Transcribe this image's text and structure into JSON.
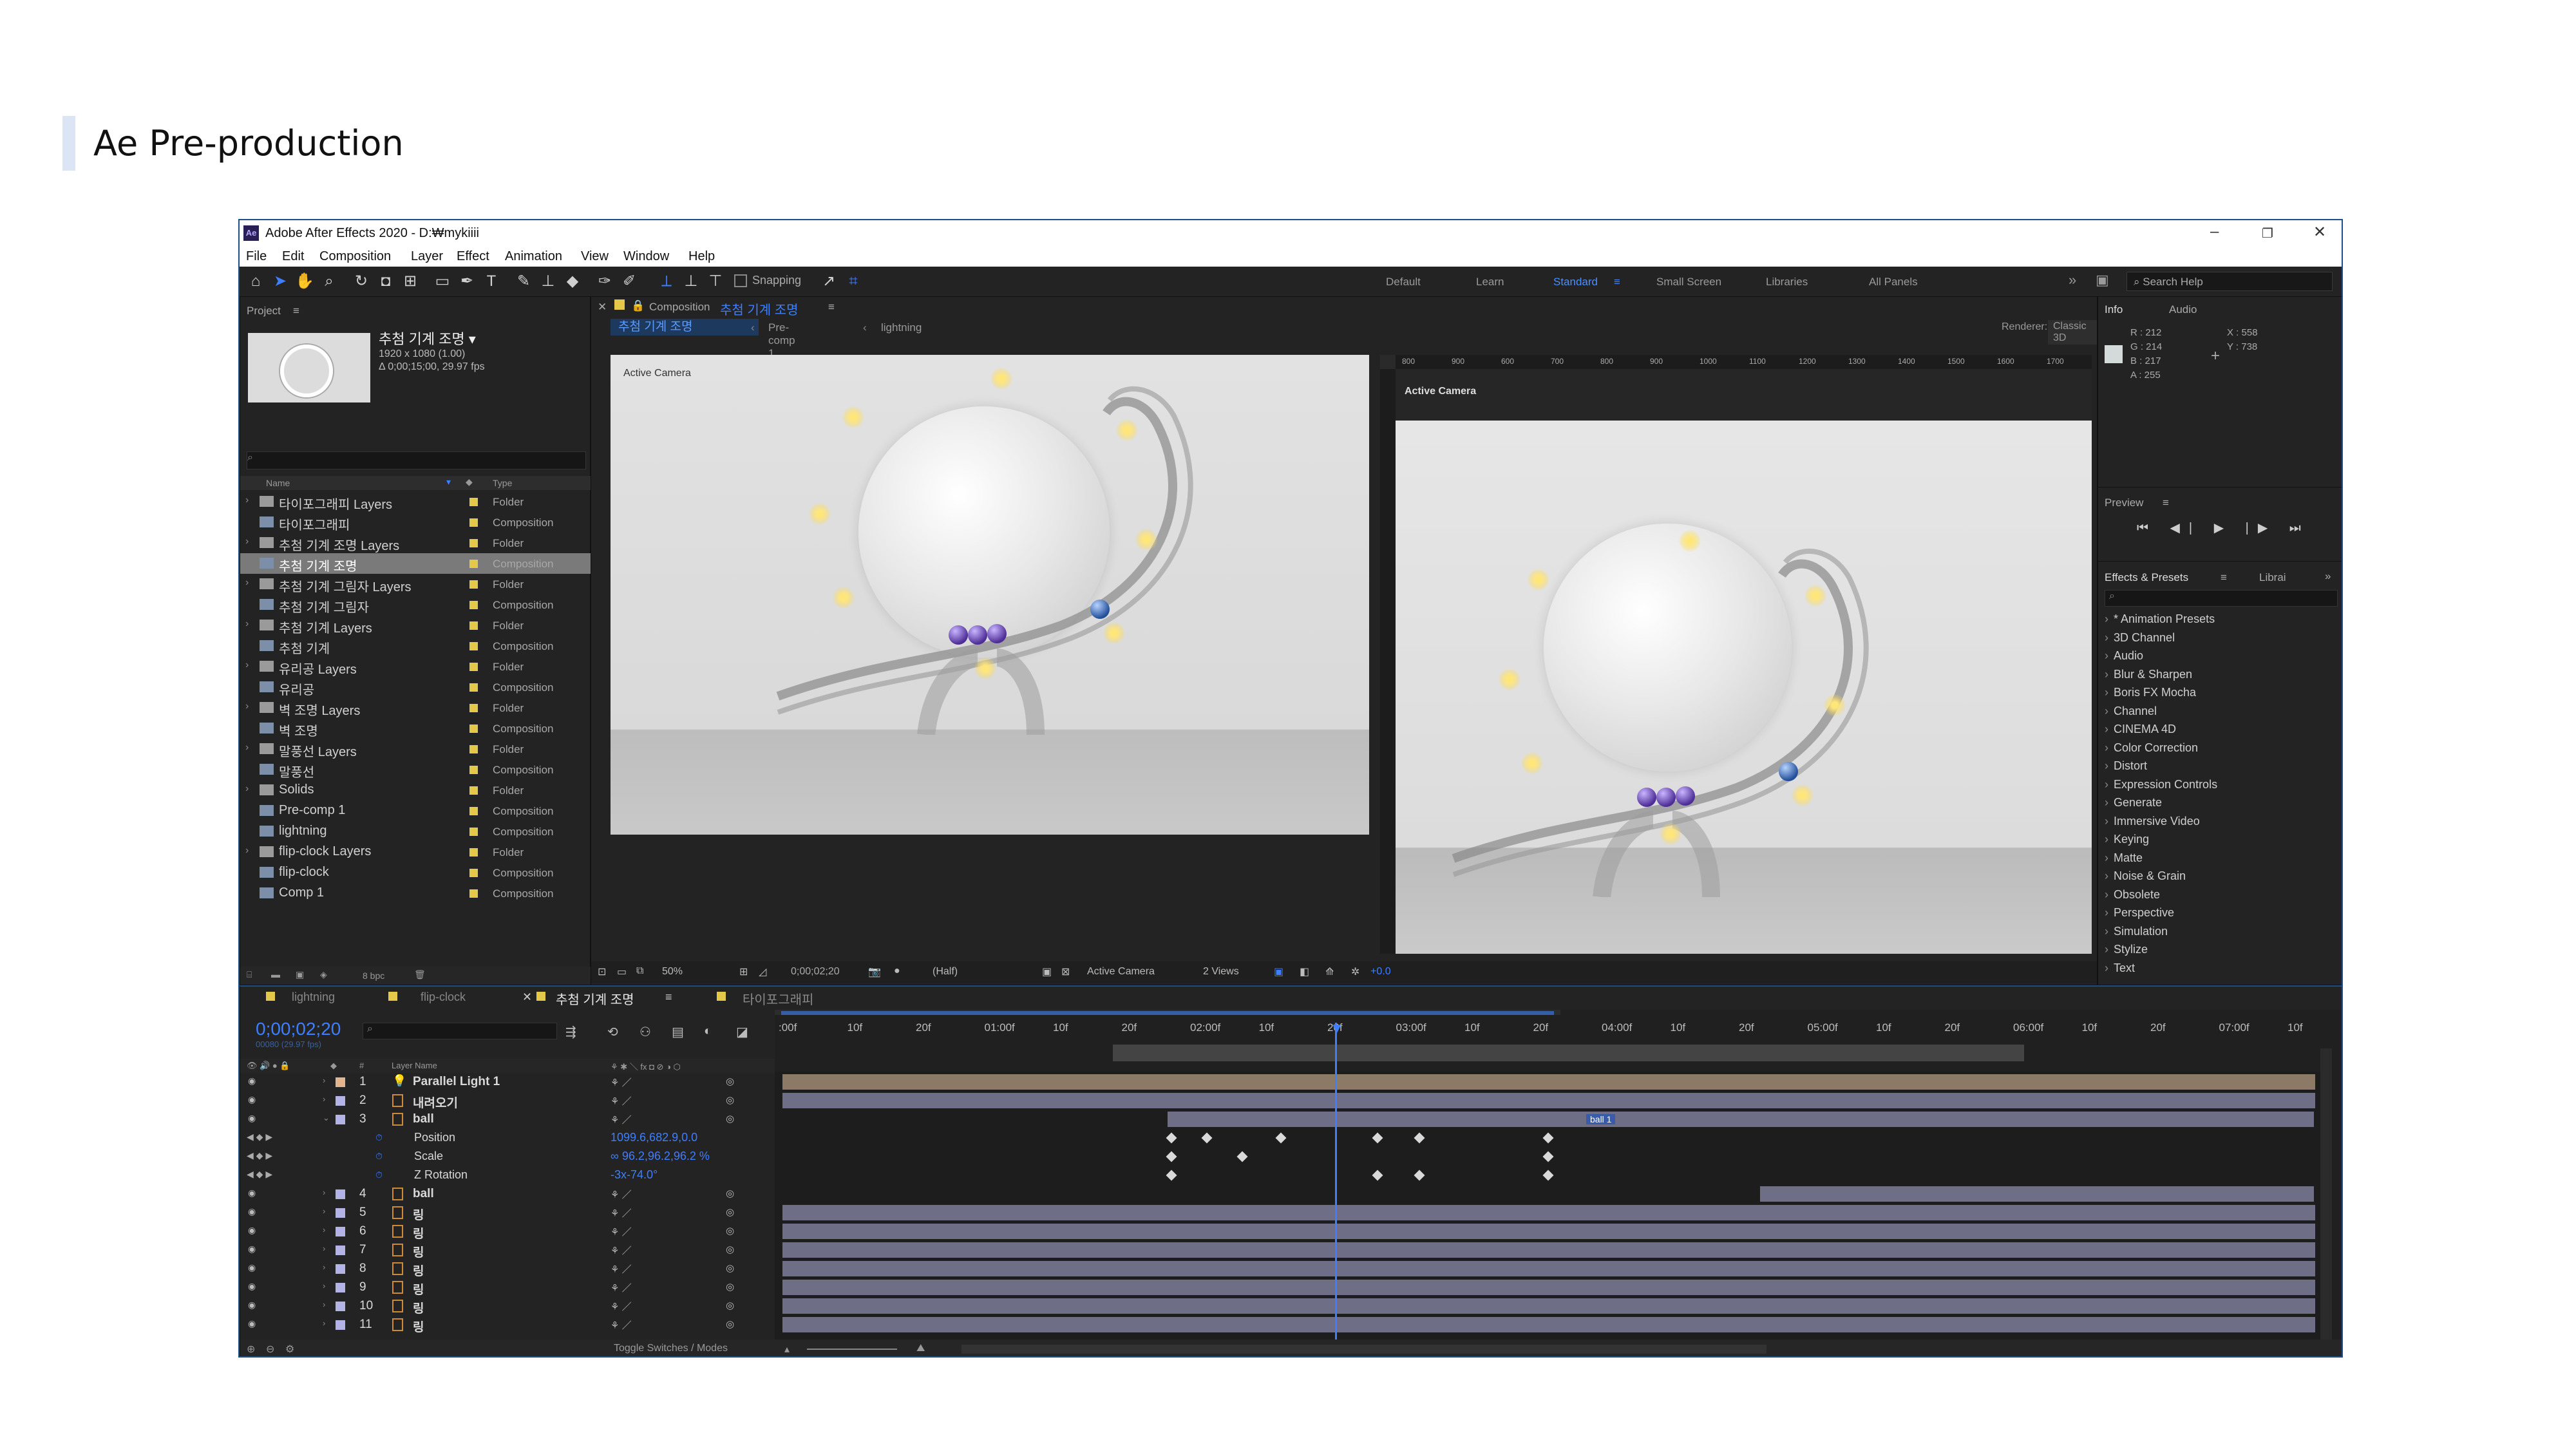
{
  "slide": {
    "title": "Ae Pre-production"
  },
  "window": {
    "title": "Adobe After Effects 2020 - D:₩mykiiii",
    "menu": [
      "File",
      "Edit",
      "Composition",
      "Layer",
      "Effect",
      "Animation",
      "View",
      "Window",
      "Help"
    ],
    "snapping": "Snapping",
    "workspaces": [
      "Default",
      "Learn",
      "Standard",
      "Small Screen",
      "Libraries",
      "All Panels"
    ],
    "active_workspace": "Standard",
    "search_help": "Search Help"
  },
  "project": {
    "tab": "Project",
    "comp_name": "추첨 기계 조명 ▾",
    "comp_res": "1920 x 1080 (1.00)",
    "comp_dur": "Δ 0;00;15;00, 29.97 fps",
    "col_name": "Name",
    "col_type": "Type",
    "bpc": "8 bpc",
    "items": [
      {
        "name": "타이포그래피 Layers",
        "type": "Folder",
        "kind": "folder",
        "chev": true
      },
      {
        "name": "타이포그래피",
        "type": "Composition",
        "kind": "comp"
      },
      {
        "name": "추첨 기계 조명 Layers",
        "type": "Folder",
        "kind": "folder",
        "chev": true
      },
      {
        "name": "추첨 기계 조명",
        "type": "Composition",
        "kind": "comp",
        "selected": true
      },
      {
        "name": "추첨 기계 그림자 Layers",
        "type": "Folder",
        "kind": "folder",
        "chev": true
      },
      {
        "name": "추첨 기계 그림자",
        "type": "Composition",
        "kind": "comp"
      },
      {
        "name": "추첨 기계 Layers",
        "type": "Folder",
        "kind": "folder",
        "chev": true
      },
      {
        "name": "추첨 기계",
        "type": "Composition",
        "kind": "comp"
      },
      {
        "name": "유리공 Layers",
        "type": "Folder",
        "kind": "folder",
        "chev": true
      },
      {
        "name": "유리공",
        "type": "Composition",
        "kind": "comp"
      },
      {
        "name": "벽 조명 Layers",
        "type": "Folder",
        "kind": "folder",
        "chev": true
      },
      {
        "name": "벽 조명",
        "type": "Composition",
        "kind": "comp"
      },
      {
        "name": "말풍선 Layers",
        "type": "Folder",
        "kind": "folder",
        "chev": true
      },
      {
        "name": "말풍선",
        "type": "Composition",
        "kind": "comp"
      },
      {
        "name": "Solids",
        "type": "Folder",
        "kind": "folder",
        "chev": true
      },
      {
        "name": "Pre-comp 1",
        "type": "Composition",
        "kind": "comp"
      },
      {
        "name": "lightning",
        "type": "Composition",
        "kind": "comp"
      },
      {
        "name": "flip-clock Layers",
        "type": "Folder",
        "kind": "folder",
        "chev": true
      },
      {
        "name": "flip-clock",
        "type": "Composition",
        "kind": "comp"
      },
      {
        "name": "Comp 1",
        "type": "Composition",
        "kind": "comp"
      }
    ]
  },
  "composition": {
    "tab_prefix": "Composition",
    "tab_name": "추첨 기계 조명",
    "crumbs": [
      "추첨 기계 조명",
      "Pre-comp 1",
      "lightning"
    ],
    "renderer_label": "Renderer:",
    "renderer": "Classic 3D",
    "view1_label": "Active Camera",
    "view2_label": "Active Camera",
    "ruler_ticks": [
      "800",
      "900",
      "600",
      "700",
      "800",
      "900",
      "1000",
      "1100",
      "1200",
      "1300",
      "1400",
      "1500",
      "1600",
      "1700"
    ],
    "zoom": "50%",
    "time": "0;00;02;20",
    "resolution": "(Half)",
    "camera": "Active Camera",
    "views": "2 Views",
    "exposure": "+0.0"
  },
  "info": {
    "tabs": [
      "Info",
      "Audio"
    ],
    "r": "R : 212",
    "g": "G : 214",
    "b": "B : 217",
    "a": "A : 255",
    "x": "X : 558",
    "y": "Y : 738",
    "swatch_color": "#d4d6d9"
  },
  "preview": {
    "tab": "Preview",
    "controls": "⏮ ◀| ▶ |▶ ⏭"
  },
  "effects": {
    "tab": "Effects & Presets",
    "tab2": "Librai",
    "items": [
      "* Animation Presets",
      "3D Channel",
      "Audio",
      "Blur & Sharpen",
      "Boris FX Mocha",
      "Channel",
      "CINEMA 4D",
      "Color Correction",
      "Distort",
      "Expression Controls",
      "Generate",
      "Immersive Video",
      "Keying",
      "Matte",
      "Noise & Grain",
      "Obsolete",
      "Perspective",
      "Simulation",
      "Stylize",
      "Text"
    ]
  },
  "timeline": {
    "tabs": [
      "lightning",
      "flip-clock",
      "추첨 기계 조명",
      "타이포그래피"
    ],
    "active_tab": "추첨 기계 조명",
    "timecode": "0;00;02;20",
    "fps": "00080 (29.97 fps)",
    "col_layer": "Layer Name",
    "ruler": [
      ":00f",
      "10f",
      "20f",
      "01:00f",
      "10f",
      "20f",
      "02:00f",
      "10f",
      "20f",
      "03:00f",
      "10f",
      "20f",
      "04:00f",
      "10f",
      "20f",
      "05:00f",
      "10f",
      "20f",
      "06:00f",
      "10f",
      "20f",
      "07:00f",
      "10f"
    ],
    "layers": [
      {
        "num": "1",
        "name": "Parallel Light 1",
        "color": "#e1b58f"
      },
      {
        "num": "2",
        "name": "내려오기",
        "color": "#b3b3e6"
      },
      {
        "num": "3",
        "name": "ball",
        "color": "#b3b3e6"
      },
      {
        "num": "4",
        "name": "ball",
        "color": "#b3b3e6"
      },
      {
        "num": "5",
        "name": "링",
        "color": "#b3b3e6"
      },
      {
        "num": "6",
        "name": "링",
        "color": "#b3b3e6"
      },
      {
        "num": "7",
        "name": "링",
        "color": "#b3b3e6"
      },
      {
        "num": "8",
        "name": "링",
        "color": "#b3b3e6"
      },
      {
        "num": "9",
        "name": "링",
        "color": "#b3b3e6"
      },
      {
        "num": "10",
        "name": "링",
        "color": "#b3b3e6"
      },
      {
        "num": "11",
        "name": "링",
        "color": "#b3b3e6"
      }
    ],
    "props": [
      {
        "name": "Position",
        "value": "1099.6,682.9,0.0"
      },
      {
        "name": "Scale",
        "value": "∞ 96.2,96.2,96.2 %"
      },
      {
        "name": "Z Rotation",
        "value": "-3x-74.0°"
      }
    ],
    "marker": "ball 1",
    "toggle": "Toggle Switches / Modes"
  },
  "colors": {
    "accent": "#3d7fff",
    "label_yellow": "#e4c84a",
    "layer_purple": "#6e6e86",
    "light_tan": "#8c7a66"
  }
}
